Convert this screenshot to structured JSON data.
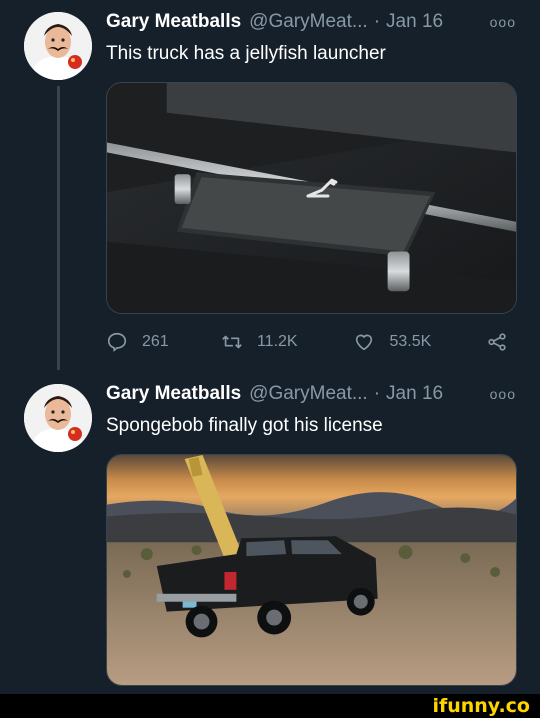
{
  "tweets": [
    {
      "name": "Gary Meatballs",
      "handle": "@GaryMeat...",
      "separator": "·",
      "date": "Jan 16",
      "more": "ooo",
      "text": "This truck has a jellyfish launcher",
      "stats": {
        "replies": "261",
        "retweets": "11.2K",
        "likes": "53.5K"
      }
    },
    {
      "name": "Gary Meatballs",
      "handle": "@GaryMeat...",
      "separator": "·",
      "date": "Jan 16",
      "more": "ooo",
      "text": "Spongebob finally got his license"
    }
  ],
  "icons": {
    "reply": "reply-icon",
    "retweet": "retweet-icon",
    "like": "heart-icon",
    "share": "share-icon",
    "more": "more-icon"
  },
  "colors": {
    "background": "#15202b",
    "muted": "#8899a6",
    "border": "#38444d",
    "watermark": "#ffd500"
  },
  "watermark": "ifunny.co"
}
